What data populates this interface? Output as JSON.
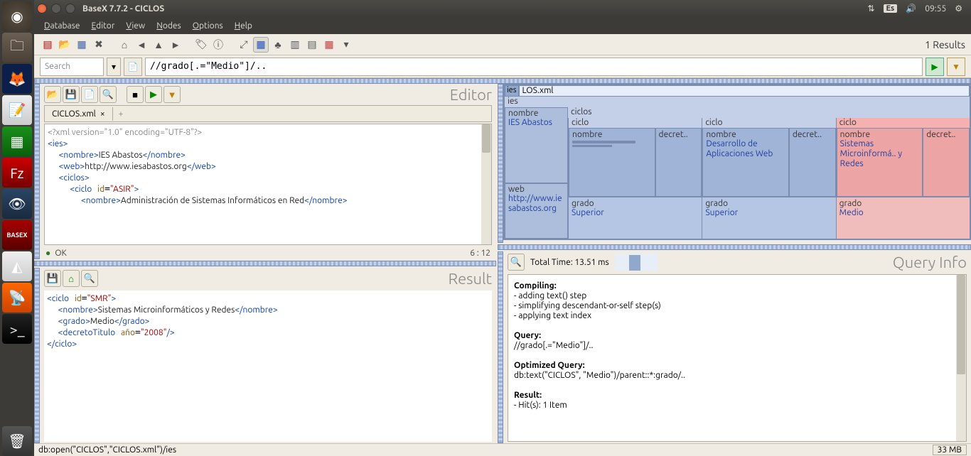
{
  "titlebar": {
    "appname": "BaseX 7.7.2 - CICLOS"
  },
  "systray": {
    "keyboard": "Es",
    "time": "09:55"
  },
  "menu": {
    "database": "Database",
    "editor": "Editor",
    "view": "View",
    "nodes": "Nodes",
    "options": "Options",
    "help": "Help"
  },
  "toolbar": {
    "results": "1 Results"
  },
  "search": {
    "placeholder": "Search",
    "query": "//grado[.=\"Medio\"]/.."
  },
  "editor": {
    "title": "Editor",
    "tab": "CICLOS.xml",
    "status_ok": "OK",
    "cursor": "6 : 12",
    "xml": {
      "decl": "<?xml version=\"1.0\" encoding=\"UTF-8\"?>",
      "nombre": "IES Abastos",
      "web": "http://www.iesabastos.org",
      "ciclo_id": "ASIR",
      "ciclo_nombre": "Administración de Sistemas Informáticos en Red"
    }
  },
  "result": {
    "title": "Result",
    "ciclo_id": "SMR",
    "nombre": "Sistemas Microinformáticos y Redes",
    "grado": "Medio",
    "decreto_ano": "2008"
  },
  "map": {
    "db": "ies",
    "file": "LOS.xml",
    "root": "ies",
    "nombre_label": "nombre",
    "nombre_val": "IES Abastos",
    "web_label": "web",
    "web_val": "http://www.iesabastos.org",
    "ciclos_label": "ciclos",
    "ciclo_label": "ciclo",
    "name_label": "nombre",
    "decret_label": "decret..",
    "grado_label": "grado",
    "c1_name": "",
    "c1_grado": "Superior",
    "c2_name": "Desarrollo de Aplicaciones Web",
    "c2_grado": "Superior",
    "c3_name": "Sistemas Microinformá.. y Redes",
    "c3_grado": "Medio"
  },
  "queryinfo": {
    "title": "Query Info",
    "total": "Total Time: 13.51 ms",
    "compiling": "Compiling:",
    "c1": "- adding text() step",
    "c2": "- simplifying descendant-or-self step(s)",
    "c3": "- applying text index",
    "query_h": "Query:",
    "query_v": "//grado[.=\"Medio\"]/..",
    "opt_h": "Optimized Query:",
    "opt_v": "db:text(\"CICLOS\", \"Medio\")/parent::*:grado/..",
    "res_h": "Result:",
    "res_v": "- Hit(s): 1 Item"
  },
  "bottom": {
    "path": "db:open(\"CICLOS\",\"CICLOS.xml\")/ies",
    "mem": "33 MB"
  }
}
